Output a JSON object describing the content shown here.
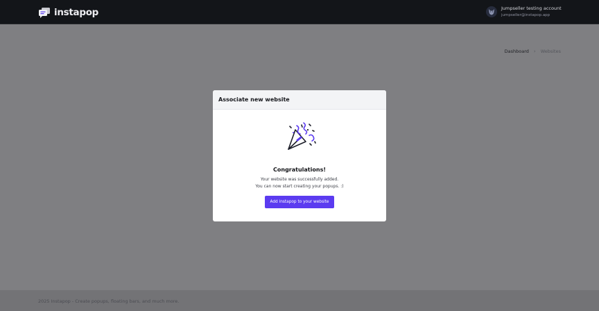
{
  "brand": {
    "name": "instapop",
    "logo_icon": "chat-bubbles-logo-icon"
  },
  "account": {
    "name": "Jumpseller testing account",
    "email": "jumpseller@instapop.app",
    "avatar_icon": "wolf-avatar-icon"
  },
  "breadcrumb": {
    "home": "Dashboard",
    "separator": "›",
    "current": "Websites"
  },
  "modal": {
    "title": "Associate new website",
    "illustration_icon": "party-popper-icon",
    "heading": "Congratulations!",
    "message_line1": "Your website was successfully added.",
    "message_line2": "You can now start creating your popups. :)",
    "cta_label": "Add instapop to your website"
  },
  "footer": {
    "text": "2025 Instapop - Create popups, floating bars, and much more."
  },
  "colors": {
    "accent": "#5b3bf0",
    "topbar": "#131519",
    "overlay": "#7f7f82",
    "modal_header": "#f3f4f6"
  }
}
